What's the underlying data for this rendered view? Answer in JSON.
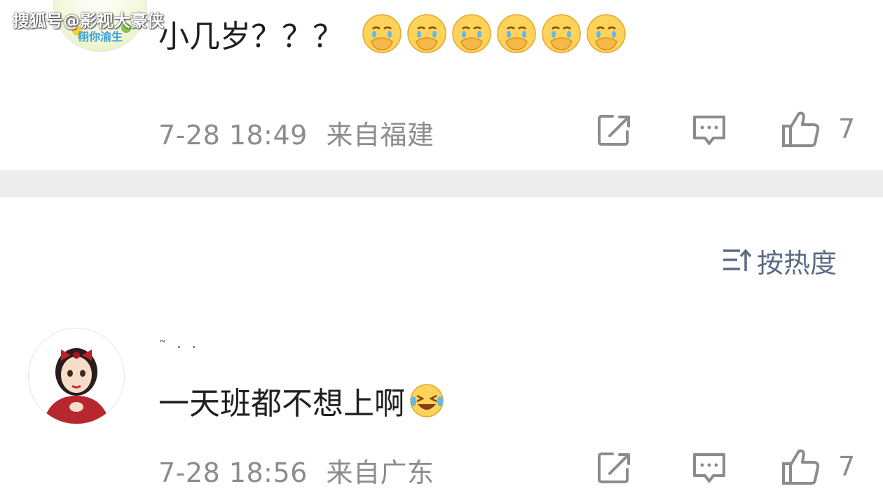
{
  "watermark": "搜狐号@影视大豪侠",
  "comments": [
    {
      "avatar_text": "栩你渝生",
      "text": "小几岁？？？",
      "emojis": [
        "cry-covering-mouth-emoji",
        "cry-covering-mouth-emoji",
        "cry-covering-mouth-emoji",
        "cry-covering-mouth-emoji",
        "cry-covering-mouth-emoji",
        "cry-covering-mouth-emoji"
      ],
      "timestamp": "7-28 18:49",
      "location": "来自福建",
      "likes": "7"
    },
    {
      "username": "˜     ·  ·",
      "text": "一天班都不想上啊",
      "emoji": "laugh-cry-emoji",
      "timestamp": "7-28 18:56",
      "location": "来自广东",
      "likes": "7"
    }
  ],
  "sort": {
    "label": "按热度",
    "icon": "sort-icon"
  },
  "icons": {
    "share": "share-icon",
    "comment": "comment-icon",
    "like": "thumbs-up-icon"
  },
  "colors": {
    "meta_gray": "#8c8c8c",
    "sort_blue": "#5b6b86",
    "divider": "#ededed"
  }
}
